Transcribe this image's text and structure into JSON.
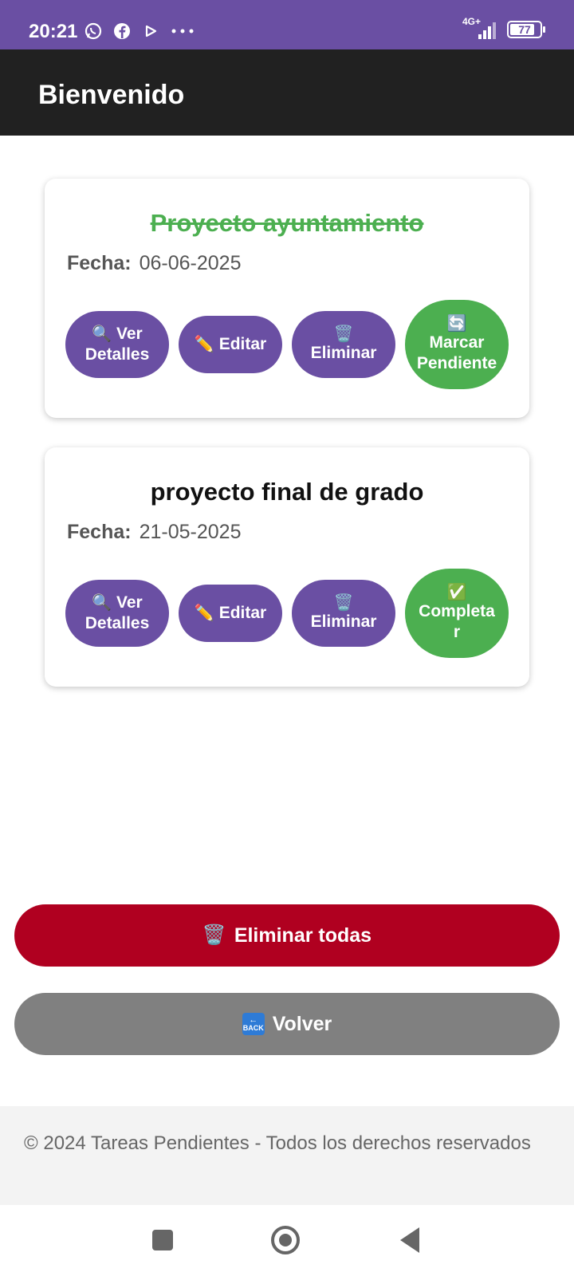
{
  "status_bar": {
    "time": "20:21",
    "network": "4G+",
    "battery": "77",
    "icons": [
      "whatsapp-icon",
      "facebook-icon",
      "play-icon",
      "more-icon",
      "signal-icon",
      "battery-icon"
    ]
  },
  "app_bar": {
    "title": "Bienvenido"
  },
  "tasks": [
    {
      "title": "Proyecto ayuntamiento",
      "completed": true,
      "date_label": "Fecha:",
      "date": "06-06-2025",
      "buttons": {
        "details_emoji": "🔍",
        "details": "Ver Detalles",
        "edit_emoji": "✏️",
        "edit": "Editar",
        "delete_emoji": "🗑️",
        "delete": "Eliminar",
        "toggle_emoji": "🔄",
        "toggle": "Marcar Pendiente"
      }
    },
    {
      "title": "proyecto final de grado",
      "completed": false,
      "date_label": "Fecha:",
      "date": "21-05-2025",
      "buttons": {
        "details_emoji": "🔍",
        "details": "Ver Detalles",
        "edit_emoji": "✏️",
        "edit": "Editar",
        "delete_emoji": "🗑️",
        "delete": "Eliminar",
        "toggle_emoji": "✅",
        "toggle": "Completa r"
      }
    }
  ],
  "actions": {
    "delete_all_emoji": "🗑️",
    "delete_all": "Eliminar todas",
    "back_emoji": "BACK",
    "back": "Volver"
  },
  "footer": {
    "text": "© 2024 Tareas Pendientes - Todos los derechos reservados"
  },
  "colors": {
    "status_bar": "#6a4fa3",
    "app_bar": "#212121",
    "primary": "#6a4fa3",
    "success": "#4caf50",
    "danger": "#b00020",
    "neutral": "#808080"
  }
}
